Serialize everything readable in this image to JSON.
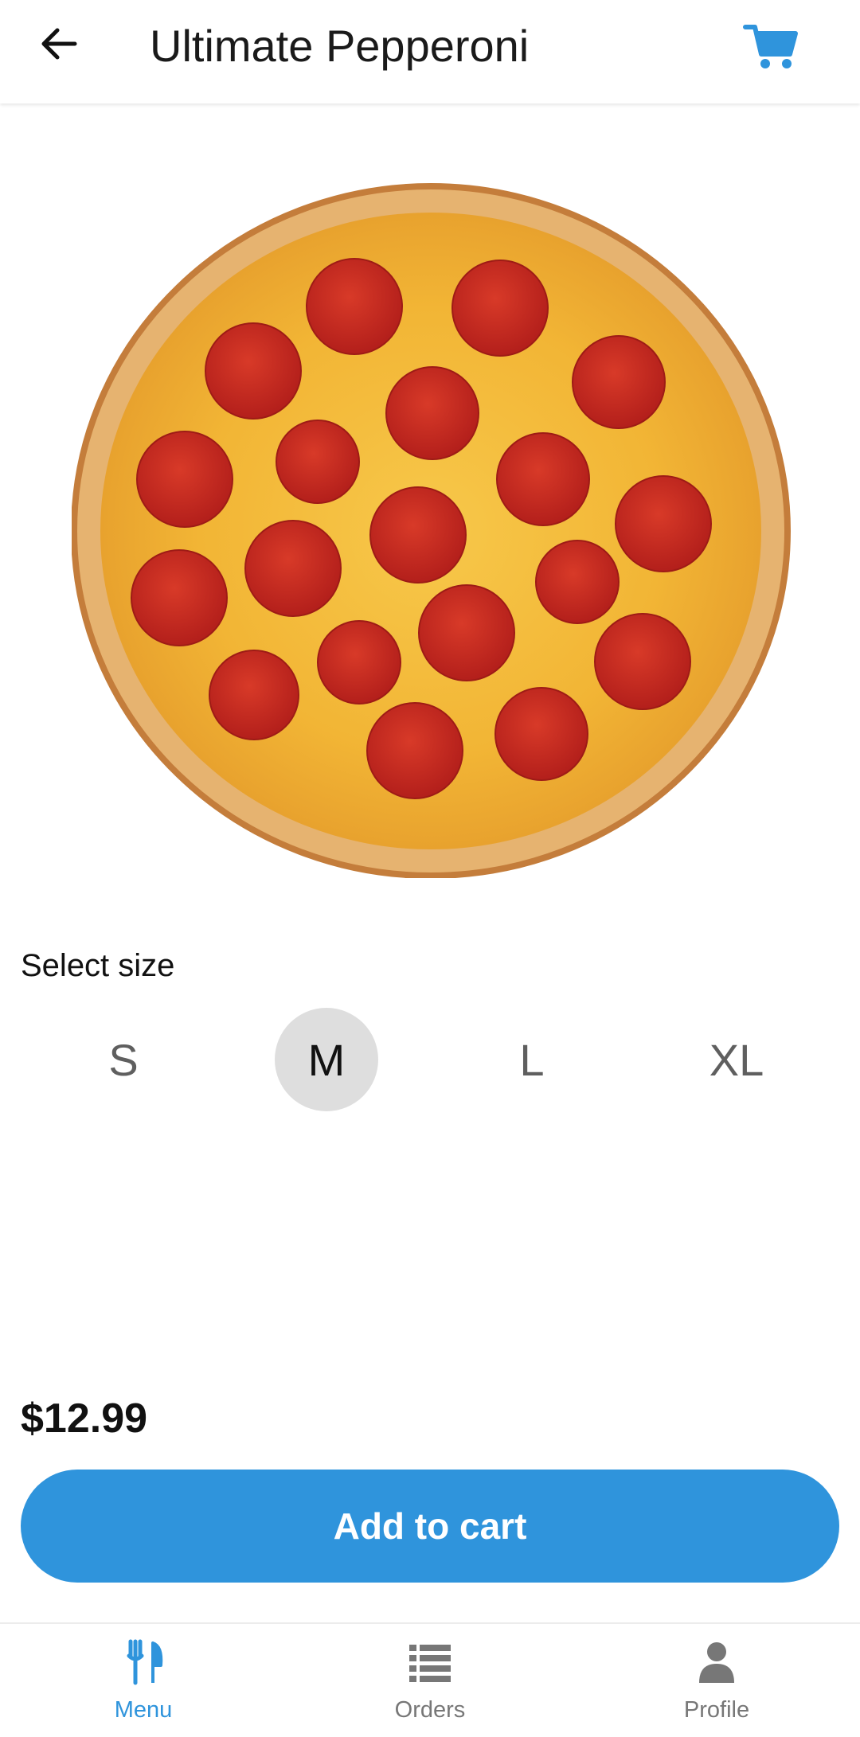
{
  "header": {
    "title": "Ultimate Pepperoni",
    "back_icon": "arrow-left-icon",
    "cart_icon": "shopping-cart-icon"
  },
  "product": {
    "image": "pepperoni-pizza-image"
  },
  "size_selector": {
    "label": "Select size",
    "options": [
      "S",
      "M",
      "L",
      "XL"
    ],
    "selected": "M"
  },
  "price": "$12.99",
  "add_to_cart_label": "Add to cart",
  "bottom_nav": {
    "items": [
      {
        "label": "Menu",
        "icon": "fork-knife-icon",
        "active": true
      },
      {
        "label": "Orders",
        "icon": "list-icon",
        "active": false
      },
      {
        "label": "Profile",
        "icon": "person-icon",
        "active": false
      }
    ]
  },
  "colors": {
    "accent": "#2f94dc",
    "selected_bg": "#dedede",
    "inactive_nav": "#777777"
  }
}
